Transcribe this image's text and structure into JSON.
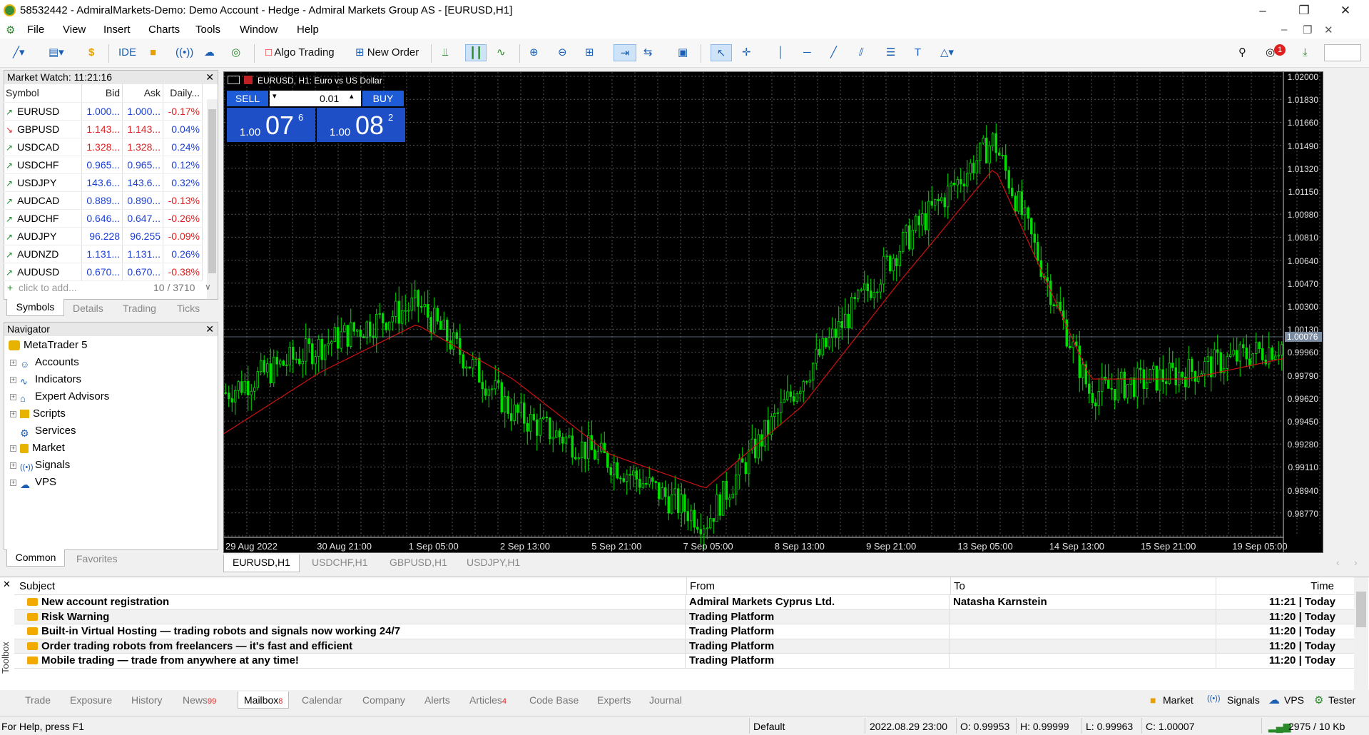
{
  "window": {
    "title": "58532442 - AdmiralMarkets-Demo: Demo Account - Hedge - Admiral Markets Group AS - [EURUSD,H1]"
  },
  "menu": [
    "File",
    "View",
    "Insert",
    "Charts",
    "Tools",
    "Window",
    "Help"
  ],
  "toolbar": {
    "ide": "IDE",
    "algo_trading": "Algo Trading",
    "new_order": "New Order",
    "notification_count": "1"
  },
  "market_watch": {
    "title": "Market Watch: 11:21:16",
    "columns": [
      "Symbol",
      "Bid",
      "Ask",
      "Daily..."
    ],
    "rows": [
      {
        "symbol": "EURUSD",
        "bid": "1.000...",
        "ask": "1.000...",
        "change": "-0.17%",
        "dir": "up",
        "bidc": "blue",
        "chg": "red"
      },
      {
        "symbol": "GBPUSD",
        "bid": "1.143...",
        "ask": "1.143...",
        "change": "0.04%",
        "dir": "down",
        "bidc": "red",
        "chg": "blue"
      },
      {
        "symbol": "USDCAD",
        "bid": "1.328...",
        "ask": "1.328...",
        "change": "0.24%",
        "dir": "up",
        "bidc": "red",
        "chg": "blue"
      },
      {
        "symbol": "USDCHF",
        "bid": "0.965...",
        "ask": "0.965...",
        "change": "0.12%",
        "dir": "up",
        "bidc": "blue",
        "chg": "blue"
      },
      {
        "symbol": "USDJPY",
        "bid": "143.6...",
        "ask": "143.6...",
        "change": "0.32%",
        "dir": "up",
        "bidc": "blue",
        "chg": "blue"
      },
      {
        "symbol": "AUDCAD",
        "bid": "0.889...",
        "ask": "0.890...",
        "change": "-0.13%",
        "dir": "up",
        "bidc": "blue",
        "chg": "red"
      },
      {
        "symbol": "AUDCHF",
        "bid": "0.646...",
        "ask": "0.647...",
        "change": "-0.26%",
        "dir": "up",
        "bidc": "blue",
        "chg": "red"
      },
      {
        "symbol": "AUDJPY",
        "bid": "96.228",
        "ask": "96.255",
        "change": "-0.09%",
        "dir": "up",
        "bidc": "blue",
        "chg": "red"
      },
      {
        "symbol": "AUDNZD",
        "bid": "1.131...",
        "ask": "1.131...",
        "change": "0.26%",
        "dir": "up",
        "bidc": "blue",
        "chg": "blue"
      },
      {
        "symbol": "AUDUSD",
        "bid": "0.670...",
        "ask": "0.670...",
        "change": "-0.38%",
        "dir": "up",
        "bidc": "blue",
        "chg": "red"
      }
    ],
    "add_placeholder": "click to add...",
    "count": "10 / 3710",
    "tabs": [
      "Symbols",
      "Details",
      "Trading",
      "Ticks"
    ]
  },
  "navigator": {
    "title": "Navigator",
    "root": "MetaTrader 5",
    "items": [
      "Accounts",
      "Indicators",
      "Expert Advisors",
      "Scripts",
      "Services",
      "Market",
      "Signals",
      "VPS"
    ],
    "tabs": [
      "Common",
      "Favorites"
    ]
  },
  "chart": {
    "header": "EURUSD, H1:  Euro vs US Dollar",
    "sell_label": "SELL",
    "buy_label": "BUY",
    "lot": "0.01",
    "sell_price_small": "1.00",
    "sell_price_big": "07",
    "sell_price_sup": "6",
    "buy_price_small": "1.00",
    "buy_price_big": "08",
    "buy_price_sup": "2",
    "y_labels": [
      "1.02000",
      "1.01830",
      "1.01660",
      "1.01490",
      "1.01320",
      "1.01150",
      "1.00980",
      "1.00810",
      "1.00640",
      "1.00470",
      "1.00300",
      "1.00130",
      "0.99960",
      "0.99790",
      "0.99620",
      "0.99450",
      "0.99280",
      "0.99110",
      "0.98940",
      "0.98770"
    ],
    "current_price": "1.00076",
    "x_labels": [
      "29 Aug 2022",
      "30 Aug 21:00",
      "1 Sep 05:00",
      "2 Sep 13:00",
      "5 Sep 21:00",
      "7 Sep 05:00",
      "8 Sep 13:00",
      "9 Sep 21:00",
      "13 Sep 05:00",
      "14 Sep 13:00",
      "15 Sep 21:00",
      "19 Sep 05:00"
    ],
    "candle_color": "#00e000",
    "ma_color": "#d01010"
  },
  "chart_data": {
    "type": "line",
    "title": "EURUSD, H1:  Euro vs US Dollar",
    "xlabel": "",
    "ylabel": "",
    "ylim": [
      0.987,
      1.021
    ],
    "categories": [
      "29 Aug 2022",
      "30 Aug 21:00",
      "1 Sep 05:00",
      "2 Sep 13:00",
      "5 Sep 21:00",
      "7 Sep 05:00",
      "8 Sep 13:00",
      "9 Sep 21:00",
      "13 Sep 05:00",
      "14 Sep 13:00",
      "15 Sep 21:00",
      "19 Sep 05:00"
    ],
    "series": [
      {
        "values": [
          0.9975,
          1.001,
          1.004,
          0.996,
          0.9925,
          0.988,
          0.9985,
          1.008,
          1.016,
          0.9975,
          0.999,
          1.001
        ]
      },
      {
        "values": [
          0.9945,
          0.999,
          1.0025,
          0.9985,
          0.993,
          0.9905,
          0.9965,
          1.0055,
          1.014,
          0.9985,
          0.9985,
          1.0
        ]
      }
    ]
  },
  "chart_tabs": [
    "EURUSD,H1",
    "USDCHF,H1",
    "GBPUSD,H1",
    "USDJPY,H1"
  ],
  "toolbox": {
    "label": "Toolbox",
    "columns": [
      "Subject",
      "From",
      "To",
      "Time"
    ],
    "rows": [
      {
        "subject": "New account registration",
        "from": "Admiral Markets Cyprus Ltd.",
        "to": "Natasha Karnstein",
        "time": "11:21 | Today"
      },
      {
        "subject": "Risk Warning",
        "from": "Trading Platform",
        "to": "",
        "time": "11:20 | Today"
      },
      {
        "subject": "Built-in Virtual Hosting — trading robots and signals now working 24/7",
        "from": "Trading Platform",
        "to": "",
        "time": "11:20 | Today"
      },
      {
        "subject": "Order trading robots from freelancers — it's fast and efficient",
        "from": "Trading Platform",
        "to": "",
        "time": "11:20 | Today"
      },
      {
        "subject": "Mobile trading — trade from anywhere at any time!",
        "from": "Trading Platform",
        "to": "",
        "time": "11:20 | Today"
      }
    ],
    "tabs": [
      {
        "label": "Trade",
        "badge": ""
      },
      {
        "label": "Exposure",
        "badge": ""
      },
      {
        "label": "History",
        "badge": ""
      },
      {
        "label": "News",
        "badge": "99"
      },
      {
        "label": "Mailbox",
        "badge": "8"
      },
      {
        "label": "Calendar",
        "badge": ""
      },
      {
        "label": "Company",
        "badge": ""
      },
      {
        "label": "Alerts",
        "badge": ""
      },
      {
        "label": "Articles",
        "badge": "4"
      },
      {
        "label": "Code Base",
        "badge": ""
      },
      {
        "label": "Experts",
        "badge": ""
      },
      {
        "label": "Journal",
        "badge": ""
      }
    ],
    "right_tabs": [
      "Market",
      "Signals",
      "VPS",
      "Tester"
    ]
  },
  "status": {
    "help": "For Help, press F1",
    "profile": "Default",
    "datetime": "2022.08.29 23:00",
    "open": "O: 0.99953",
    "high": "H: 0.99999",
    "low": "L: 0.99963",
    "close": "C: 1.00007",
    "traffic": "2975 / 10 Kb"
  }
}
